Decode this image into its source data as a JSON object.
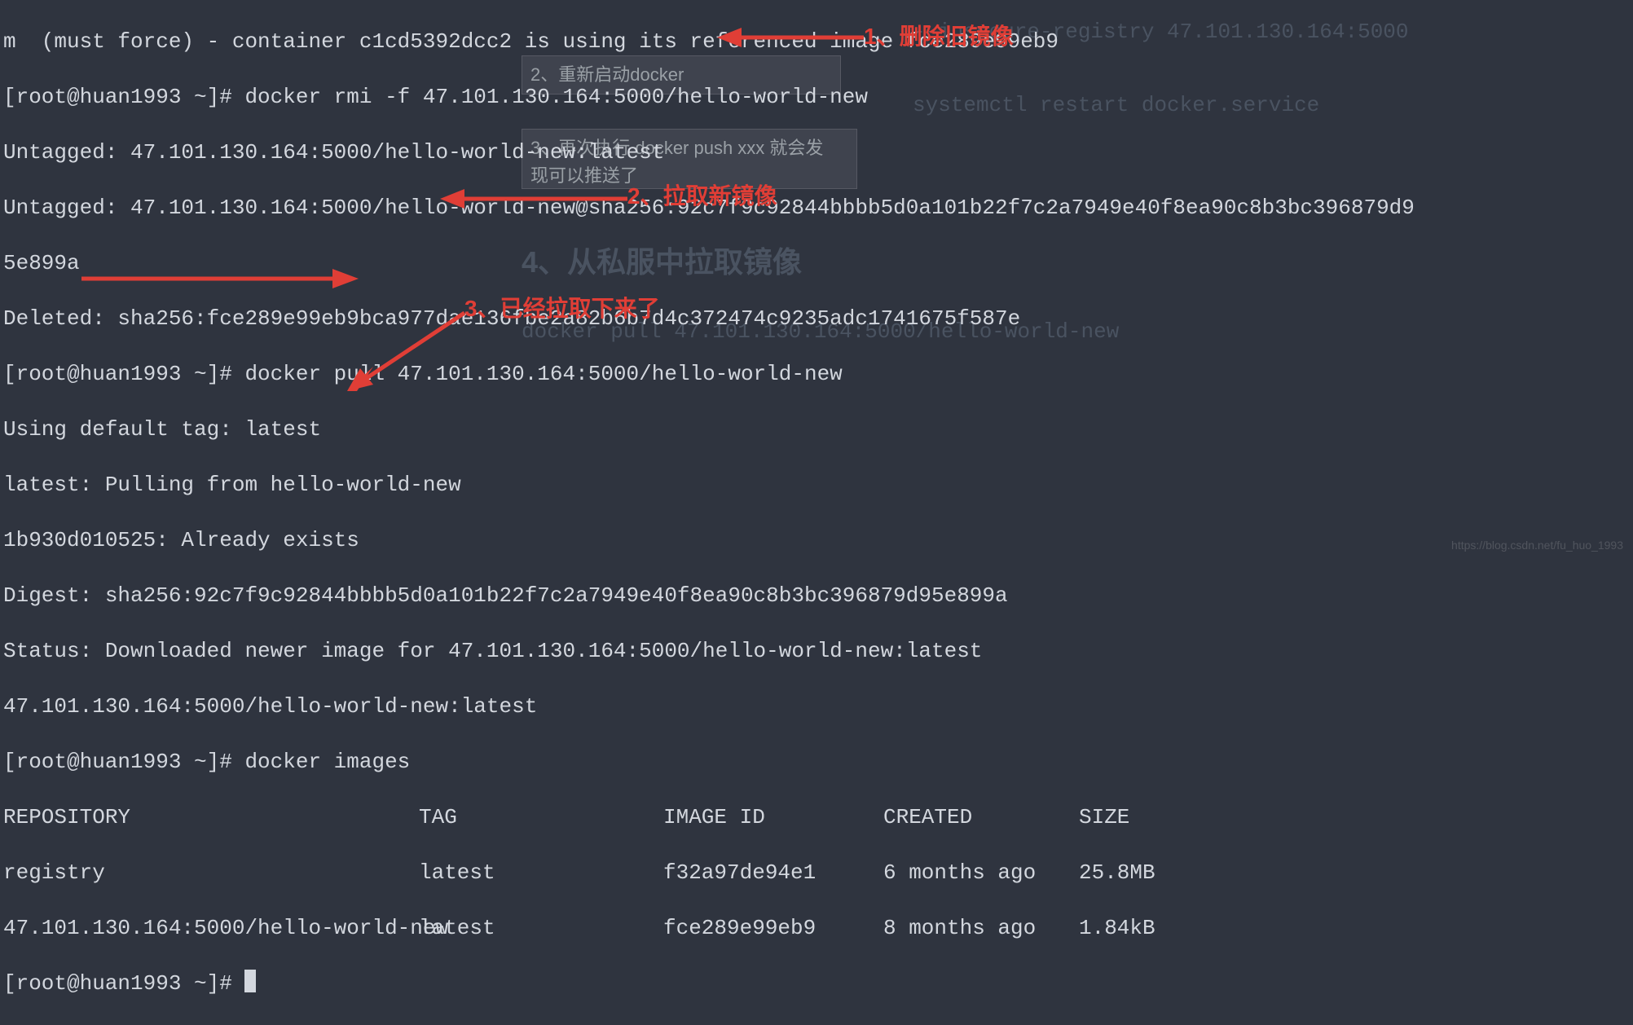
{
  "bg": {
    "flag": "--insecure-registry 47.101.130.164:5000",
    "step2": "2、重新启动docker",
    "restart": "systemctl restart docker.service",
    "step3a": "3、再次执行 docker push xxx 就会发",
    "step3b": "现可以推送了",
    "heading": "4、从私服中拉取镜像",
    "pullcmd": "docker pull 47.101.130.164:5000/hello-world-new"
  },
  "term": {
    "line0": "m  (must force) - container c1cd5392dcc2 is using its referenced image fce289e99eb9",
    "prompt": "[root@huan1993 ~]# ",
    "cmd_rmi": "docker rmi -f 47.101.130.164:5000/hello-world-new",
    "rmi_o1": "Untagged: 47.101.130.164:5000/hello-world-new:latest",
    "rmi_o2": "Untagged: 47.101.130.164:5000/hello-world-new@sha256:92c7f9c92844bbbb5d0a101b22f7c2a7949e40f8ea90c8b3bc396879d9",
    "rmi_o3": "5e899a",
    "rmi_o4": "Deleted: sha256:fce289e99eb9bca977dae136fbe2a82b6b7d4c372474c9235adc1741675f587e",
    "cmd_pull": "docker pull 47.101.130.164:5000/hello-world-new",
    "pull_o1": "Using default tag: latest",
    "pull_o2": "latest: Pulling from hello-world-new",
    "pull_o3": "1b930d010525: Already exists",
    "pull_o4": "Digest: sha256:92c7f9c92844bbbb5d0a101b22f7c2a7949e40f8ea90c8b3bc396879d95e899a",
    "pull_o5": "Status: Downloaded newer image for 47.101.130.164:5000/hello-world-new:latest",
    "pull_o6": "47.101.130.164:5000/hello-world-new:latest",
    "cmd_images": "docker images",
    "hdr": {
      "repo": "REPOSITORY",
      "tag": "TAG",
      "id": "IMAGE ID",
      "created": "CREATED",
      "size": "SIZE"
    },
    "rows": [
      {
        "repo": "registry",
        "tag": "latest",
        "id": "f32a97de94e1",
        "created": "6 months ago",
        "size": "25.8MB"
      },
      {
        "repo": "47.101.130.164:5000/hello-world-new",
        "tag": "latest",
        "id": "fce289e99eb9",
        "created": "8 months ago",
        "size": "1.84kB"
      }
    ]
  },
  "anno": {
    "a1": "1、删除旧镜像",
    "a2": "2、拉取新镜像",
    "a3": "3、已经拉取下来了"
  },
  "watermark": "https://blog.csdn.net/fu_huo_1993"
}
